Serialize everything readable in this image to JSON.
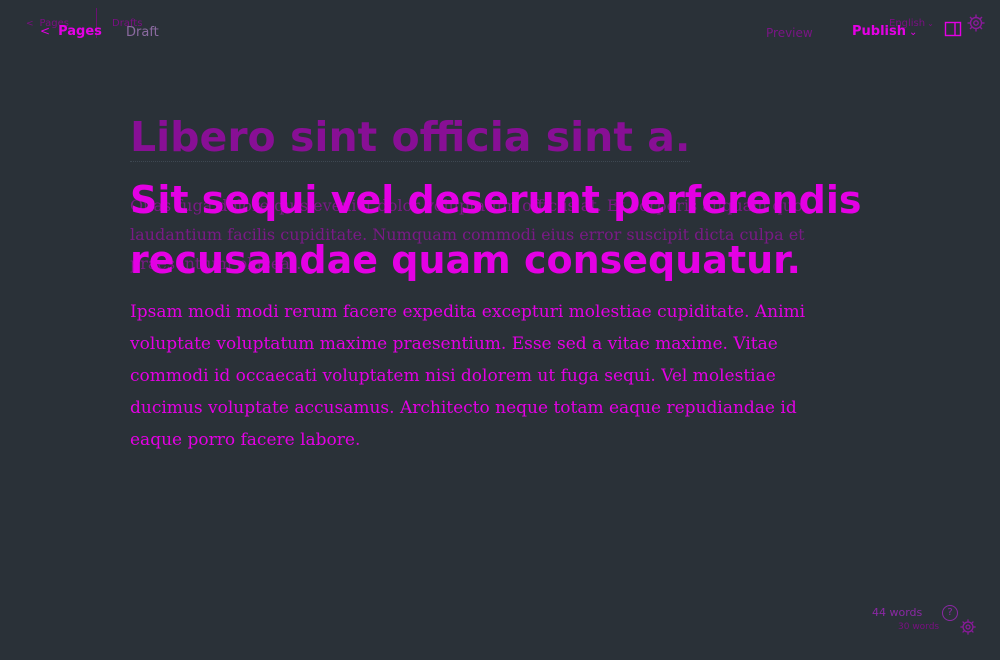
{
  "header": {
    "back_ghost_label": "Pages",
    "drafts_ghost_label": "Drafts",
    "back_label": "Pages",
    "status": "Draft",
    "preview_label": "Preview",
    "publish_label": "Publish",
    "language_label": "English"
  },
  "editor": {
    "title_ghost": "Libero sint officia sint a.",
    "title": "Sit sequi vel deserunt perferendis recusandae quam consequatur.",
    "paragraph_ghost": "Quas fuga dolore quis eveniet dolor voluptatum officiis at. Et corporis aliquam quo laudantium facilis cupiditate. Numquam commodi eius error suscipit dicta culpa et praesentium placeat.",
    "paragraph": "Ipsam modi modi rerum facere expedita excepturi molestiae cupiditate. Animi voluptate voluptatum maxime praesentium. Esse sed a vitae maxime. Vitae commodi id occaecati voluptatem nisi dolorem ut fuga sequi. Vel molestiae ducimus voluptate accusamus. Architecto neque totam eaque repudiandae id eaque porro facere labore."
  },
  "footer": {
    "word_count": "44 words",
    "help_icon_glyph": "?",
    "word_count_ghost": "30 words"
  },
  "icons": {
    "back": "chevron-left-icon",
    "publish_caret": "chevron-down-icon",
    "language_caret": "chevron-down-icon",
    "sidebar": "sidebar-toggle-icon",
    "settings": "gear-icon",
    "help": "help-icon"
  },
  "colors": {
    "background": "#2a3138",
    "accent": "#e400e4",
    "muted": "#7a0f82"
  }
}
